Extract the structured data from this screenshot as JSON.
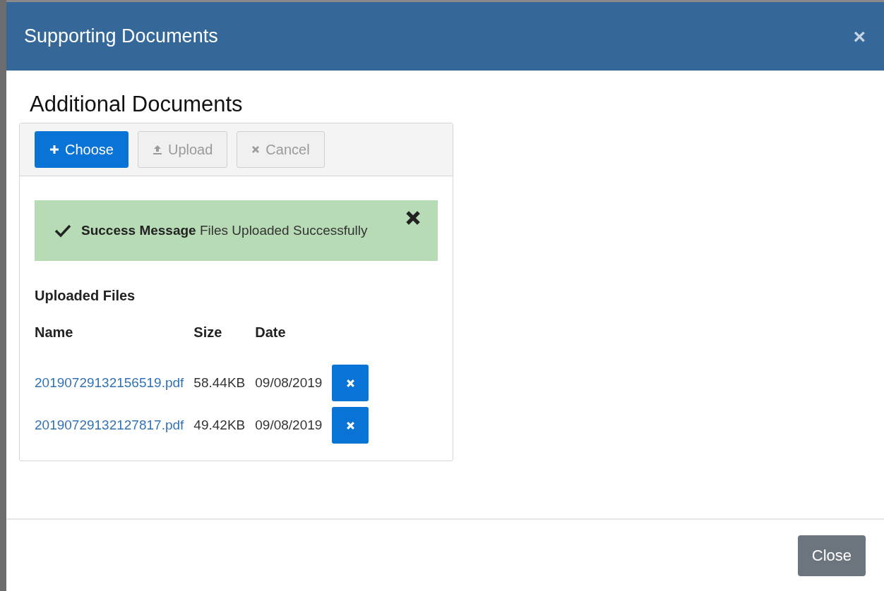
{
  "dialog": {
    "title": "Supporting Documents",
    "close_label": "×"
  },
  "section_title": "Additional Documents",
  "toolbar": [
    {
      "kind": "choose",
      "label": "Choose",
      "disabled": false
    },
    {
      "kind": "upload",
      "label": "Upload",
      "disabled": true
    },
    {
      "kind": "cancel",
      "label": "Cancel",
      "disabled": true
    }
  ],
  "message": {
    "summary": "Success Message",
    "detail": "Files Uploaded Successfully"
  },
  "uploaded_files": {
    "title": "Uploaded Files",
    "columns": [
      "Name",
      "Size",
      "Date"
    ],
    "rows": [
      {
        "name": "20190729132156519.pdf",
        "size": "58.44KB",
        "date": "09/08/2019"
      },
      {
        "name": "20190729132127817.pdf",
        "size": "49.42KB",
        "date": "09/08/2019"
      }
    ]
  },
  "footer": {
    "buttons": [
      "Close"
    ]
  }
}
